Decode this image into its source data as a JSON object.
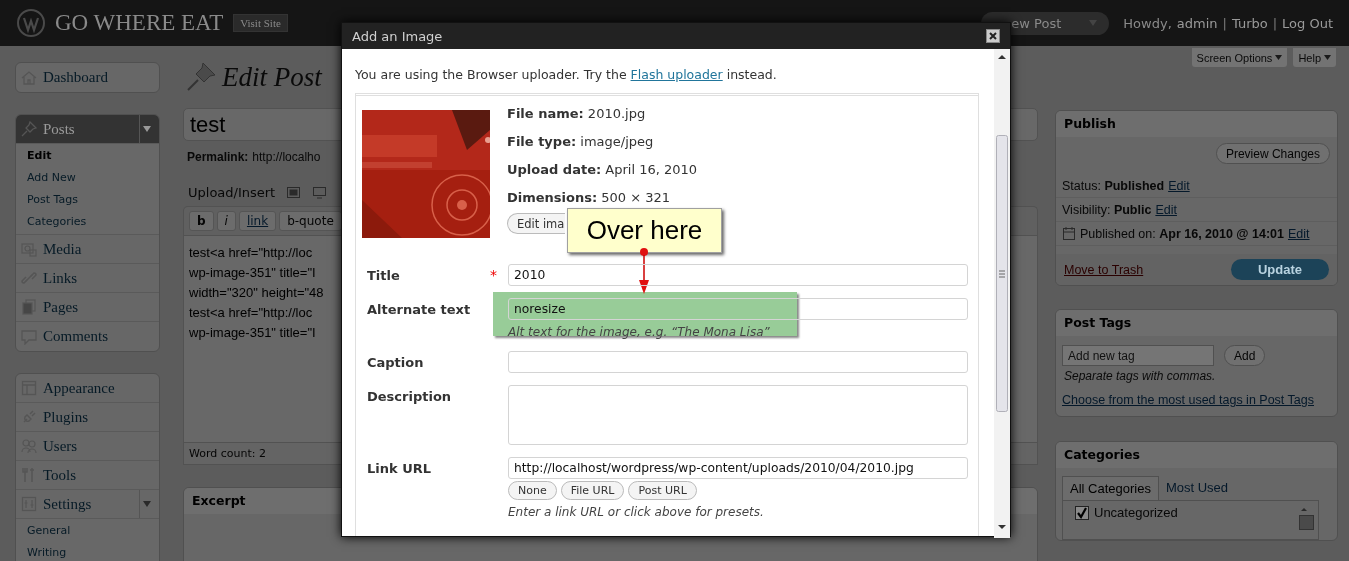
{
  "topbar": {
    "site_title": "GO WHERE EAT",
    "visit_site": "Visit Site",
    "new_post": "ew Post",
    "greeting": "Howdy,",
    "user": "admin",
    "links": [
      {
        "separator": "|",
        "label": "Turbo"
      },
      {
        "separator": "|",
        "label": "Log Out"
      }
    ]
  },
  "sidebar": {
    "groups": [
      [
        {
          "label": "Dashboard",
          "selected": false
        }
      ],
      [
        {
          "label": "Posts",
          "selected": true,
          "expanded": true,
          "children": [
            {
              "label": "Edit",
              "selected": true
            },
            {
              "label": "Add New",
              "selected": false
            },
            {
              "label": "Post Tags",
              "selected": false
            },
            {
              "label": "Categories",
              "selected": false
            }
          ]
        },
        {
          "label": "Media",
          "selected": false
        },
        {
          "label": "Links",
          "selected": false
        },
        {
          "label": "Pages",
          "selected": false
        },
        {
          "label": "Comments",
          "selected": false
        }
      ],
      [
        {
          "label": "Appearance",
          "selected": false
        },
        {
          "label": "Plugins",
          "selected": false
        },
        {
          "label": "Users",
          "selected": false
        },
        {
          "label": "Tools",
          "selected": false
        },
        {
          "label": "Settings",
          "selected": false,
          "expanded": true,
          "children": [
            {
              "label": "General",
              "selected": false
            },
            {
              "label": "Writing",
              "selected": false
            }
          ]
        }
      ]
    ]
  },
  "main": {
    "heading": "Edit Post",
    "post_title": "test",
    "permalink_label": "Permalink:",
    "permalink": "http://localho",
    "upload_label": "Upload/Insert",
    "toolbar": [
      {
        "label": "b",
        "kind": "bold"
      },
      {
        "label": "i",
        "kind": "italic"
      },
      {
        "label": "link",
        "kind": "link"
      },
      {
        "label": "b-quote",
        "kind": "plain"
      }
    ],
    "editor_lines": [
      "test<a href=\"http://loc",
      "wp-image-351\" title=\"I",
      "width=\"320\" height=\"48",
      "test<a href=\"http://loc",
      "wp-image-351\" title=\"I"
    ],
    "word_count": "Word count: 2",
    "excerpt_title": "Excerpt"
  },
  "screen_meta": [
    "Screen Options",
    "Help"
  ],
  "publish": {
    "title": "Publish",
    "preview": "Preview Changes",
    "rows": [
      {
        "label": "Status:",
        "value": "Published",
        "action": "Edit",
        "kind": "plain"
      },
      {
        "label": "Visibility:",
        "value": "Public",
        "action": "Edit",
        "kind": "plain"
      },
      {
        "label": "Published on:",
        "value": "Apr 16, 2010 @ 14:01",
        "action": "Edit",
        "kind": "date"
      }
    ],
    "trash": "Move to Trash",
    "update": "Update"
  },
  "post_tags": {
    "title": "Post Tags",
    "placeholder": "Add new tag",
    "add": "Add",
    "hint": "Separate tags with commas.",
    "link": "Choose from the most used tags in Post Tags"
  },
  "categories": {
    "title": "Categories",
    "tabs": [
      {
        "label": "All Categories",
        "selected": true
      },
      {
        "label": "Most Used",
        "selected": false
      }
    ],
    "items": [
      {
        "label": "Uncategorized",
        "checked": true
      }
    ]
  },
  "dialog": {
    "title": "Add an Image",
    "notice": {
      "before": "You are using the Browser uploader. Try the",
      "link": "Flash uploader",
      "after": "instead."
    },
    "file_info": [
      {
        "label": "File name:",
        "value": "2010.jpg"
      },
      {
        "label": "File type:",
        "value": "image/jpeg"
      },
      {
        "label": "Upload date:",
        "value": "April 16, 2010"
      },
      {
        "label": "Dimensions:",
        "value": "500 × 321"
      }
    ],
    "edit_button": "Edit ima",
    "fields": [
      {
        "label": "Title",
        "required_mark": "*",
        "kind": "input",
        "value": "2010"
      },
      {
        "label": "Alternate text",
        "kind": "input",
        "value": "noresize",
        "hint": "Alt text for the image, e.g. “The Mona Lisa”"
      },
      {
        "label": "Caption",
        "kind": "input"
      },
      {
        "label": "Description",
        "kind": "textarea"
      },
      {
        "label": "Link URL",
        "kind": "input",
        "value": "http://localhost/wordpress/wp-content/uploads/2010/04/2010.jpg",
        "buttons": [
          "None",
          "File URL",
          "Post URL"
        ],
        "hint": "Enter a link URL or click above for presets."
      }
    ]
  },
  "callout": {
    "text": "Over here"
  }
}
